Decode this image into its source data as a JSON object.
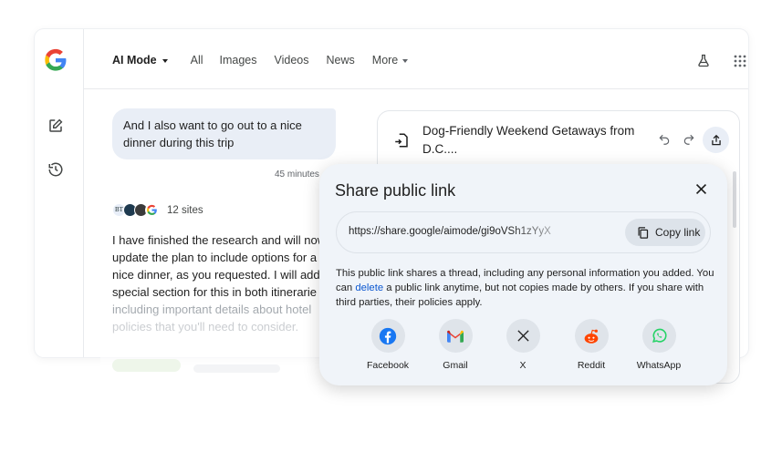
{
  "nav": {
    "ai_mode": "AI Mode",
    "all": "All",
    "images": "Images",
    "videos": "Videos",
    "news": "News",
    "more": "More"
  },
  "chat": {
    "user_message_line1": "And I also want to go out to a nice",
    "user_message_line2": "dinner during this trip",
    "timestamp": "45 minutes",
    "sites_label": "12 sites",
    "answer_lines": [
      "I have finished the research and will now",
      "update the plan to include options for a",
      "nice dinner, as you requested. I will add",
      "special section for this in both itinerarie",
      "including important details about hotel",
      "policies that you'll need to consider."
    ]
  },
  "canvas": {
    "title_line1": "Dog-Friendly Weekend Getaways from",
    "title_line2": "D.C...."
  },
  "share_dialog": {
    "title": "Share public link",
    "url": "https://share.google/aimode/gi9oVSh1zYyX",
    "copy_label": "Copy link",
    "info_part1": "This public link shares a thread, including any personal information you added. You can ",
    "info_link": "delete",
    "info_part2": " a public link anytime, but not copies made by others. If you share with third parties, their policies apply.",
    "options": [
      {
        "label": "Facebook",
        "icon": "facebook-icon"
      },
      {
        "label": "Gmail",
        "icon": "gmail-icon"
      },
      {
        "label": "X",
        "icon": "x-icon"
      },
      {
        "label": "Reddit",
        "icon": "reddit-icon"
      },
      {
        "label": "WhatsApp",
        "icon": "whatsapp-icon"
      }
    ]
  },
  "colors": {
    "link_blue": "#0b57d0",
    "dialog_bg": "#f0f4f9",
    "bubble_bg": "#e9eef6"
  }
}
